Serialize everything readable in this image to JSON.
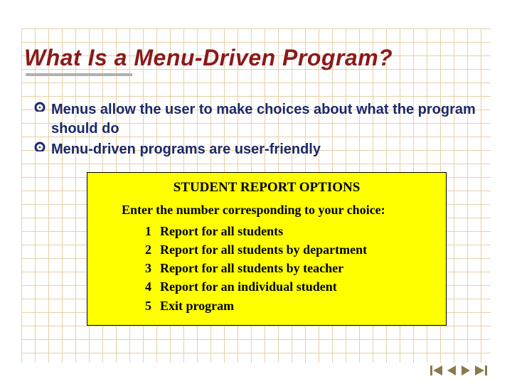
{
  "title": "What Is a Menu-Driven Program?",
  "bullets": [
    "Menus allow the user to make choices about what the program should do",
    "Menu-driven programs are user-friendly"
  ],
  "menu": {
    "title": "STUDENT REPORT OPTIONS",
    "prompt": "Enter the number corresponding to your choice:",
    "items": [
      {
        "num": "1",
        "label": "Report for all students"
      },
      {
        "num": "2",
        "label": "Report for all students by department"
      },
      {
        "num": "3",
        "label": "Report for all students by teacher"
      },
      {
        "num": "4",
        "label": "Report for an individual student"
      },
      {
        "num": "5",
        "label": "Exit program"
      }
    ]
  },
  "colors": {
    "title": "#8a1a1a",
    "bullet_text": "#1a2a6a",
    "menu_bg": "#ffff00",
    "nav": "#8a7a4a"
  }
}
